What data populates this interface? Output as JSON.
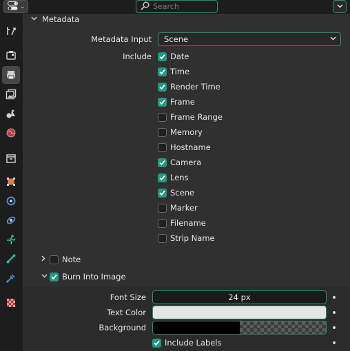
{
  "header": {
    "search_placeholder": "Search"
  },
  "tabs": [
    {
      "name": "tool",
      "active": false
    },
    {
      "name": "render",
      "active": false
    },
    {
      "name": "output",
      "active": true
    },
    {
      "name": "view-layer",
      "active": false
    },
    {
      "name": "scene",
      "active": false
    },
    {
      "name": "world",
      "active": false
    },
    {
      "name": "collection",
      "active": false
    },
    {
      "name": "object",
      "active": false
    },
    {
      "name": "modifiers",
      "active": false
    },
    {
      "name": "particles",
      "active": false
    },
    {
      "name": "physics",
      "active": false
    },
    {
      "name": "constraints",
      "active": false
    },
    {
      "name": "data",
      "active": false
    },
    {
      "name": "texture",
      "active": false
    }
  ],
  "metadata": {
    "title": "Metadata",
    "input_label": "Metadata Input",
    "input_value": "Scene",
    "include_label": "Include",
    "items": [
      {
        "label": "Date",
        "checked": true
      },
      {
        "label": "Time",
        "checked": true
      },
      {
        "label": "Render Time",
        "checked": true
      },
      {
        "label": "Frame",
        "checked": true
      },
      {
        "label": "Frame Range",
        "checked": false
      },
      {
        "label": "Memory",
        "checked": false
      },
      {
        "label": "Hostname",
        "checked": false
      },
      {
        "label": "Camera",
        "checked": true
      },
      {
        "label": "Lens",
        "checked": true
      },
      {
        "label": "Scene",
        "checked": true
      },
      {
        "label": "Marker",
        "checked": false
      },
      {
        "label": "Filename",
        "checked": false
      },
      {
        "label": "Strip Name",
        "checked": false
      }
    ],
    "note": {
      "label": "Note",
      "checked": false,
      "expanded": false
    },
    "burn": {
      "label": "Burn Into Image",
      "checked": true,
      "expanded": true,
      "font_size_label": "Font Size",
      "font_size_value": "24 px",
      "text_color_label": "Text Color",
      "text_color": "#e5e5e5",
      "background_label": "Background",
      "background_color": "#000000",
      "include_labels": {
        "label": "Include Labels",
        "checked": true
      }
    }
  },
  "colors": {
    "accent": "#1f9a83",
    "outline": "#2f8c7a"
  }
}
